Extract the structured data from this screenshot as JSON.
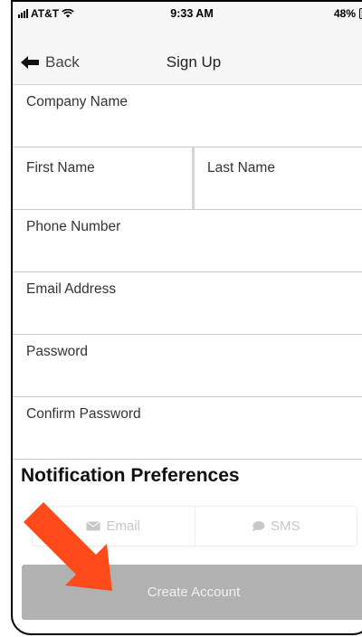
{
  "status_bar": {
    "carrier": "AT&T",
    "time": "9:33 AM",
    "battery": "48%"
  },
  "nav": {
    "back_label": "Back",
    "title": "Sign Up"
  },
  "form": {
    "company_name": "Company Name",
    "first_name": "First Name",
    "last_name": "Last Name",
    "phone_number": "Phone Number",
    "email_address": "Email Address",
    "password": "Password",
    "confirm_password": "Confirm Password"
  },
  "preferences": {
    "title": "Notification Preferences",
    "email_label": "Email",
    "sms_label": "SMS"
  },
  "create_button_label": "Create Account",
  "colors": {
    "annotation_arrow": "#ff4a1c",
    "button_disabled": "#b1b1b1"
  },
  "icons": [
    "wifi-icon",
    "back-arrow-icon",
    "envelope-icon",
    "chat-bubble-icon",
    "annotation-arrow"
  ]
}
